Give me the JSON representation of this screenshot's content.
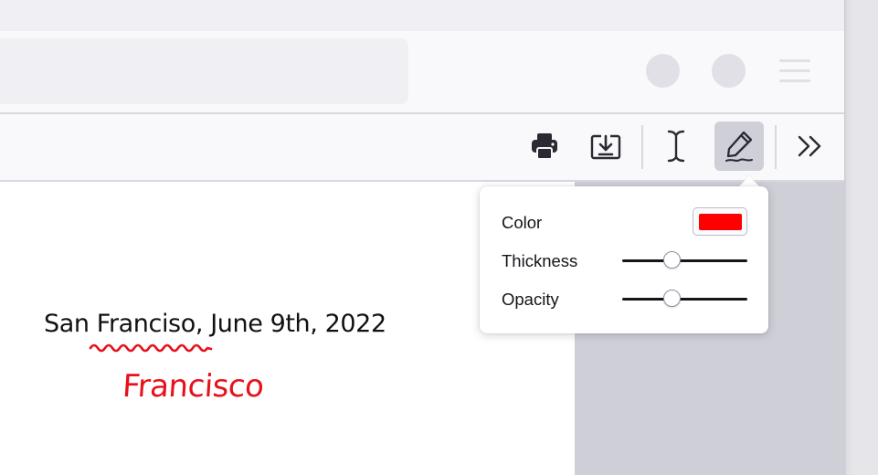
{
  "document": {
    "text": "San Franciso, June 9th, 2022",
    "handwritten_annotation": "Francisco"
  },
  "annotation_popup": {
    "color_label": "Color",
    "color_value": "#ff0000",
    "thickness_label": "Thickness",
    "thickness_value": 0.4,
    "opacity_label": "Opacity",
    "opacity_value": 0.4
  },
  "toolbar": {
    "icons": [
      "print-icon",
      "save-icon",
      "text-tool-icon",
      "draw-tool-icon",
      "more-tools-icon"
    ],
    "active_tool": "draw-tool-icon"
  },
  "colors": {
    "ink": "#e8101a",
    "tab_strip": "#f0f0f4",
    "toolbar": "#f9f9fb",
    "active_button": "#cfcfd8",
    "viewer_background": "#cfcfd8"
  }
}
